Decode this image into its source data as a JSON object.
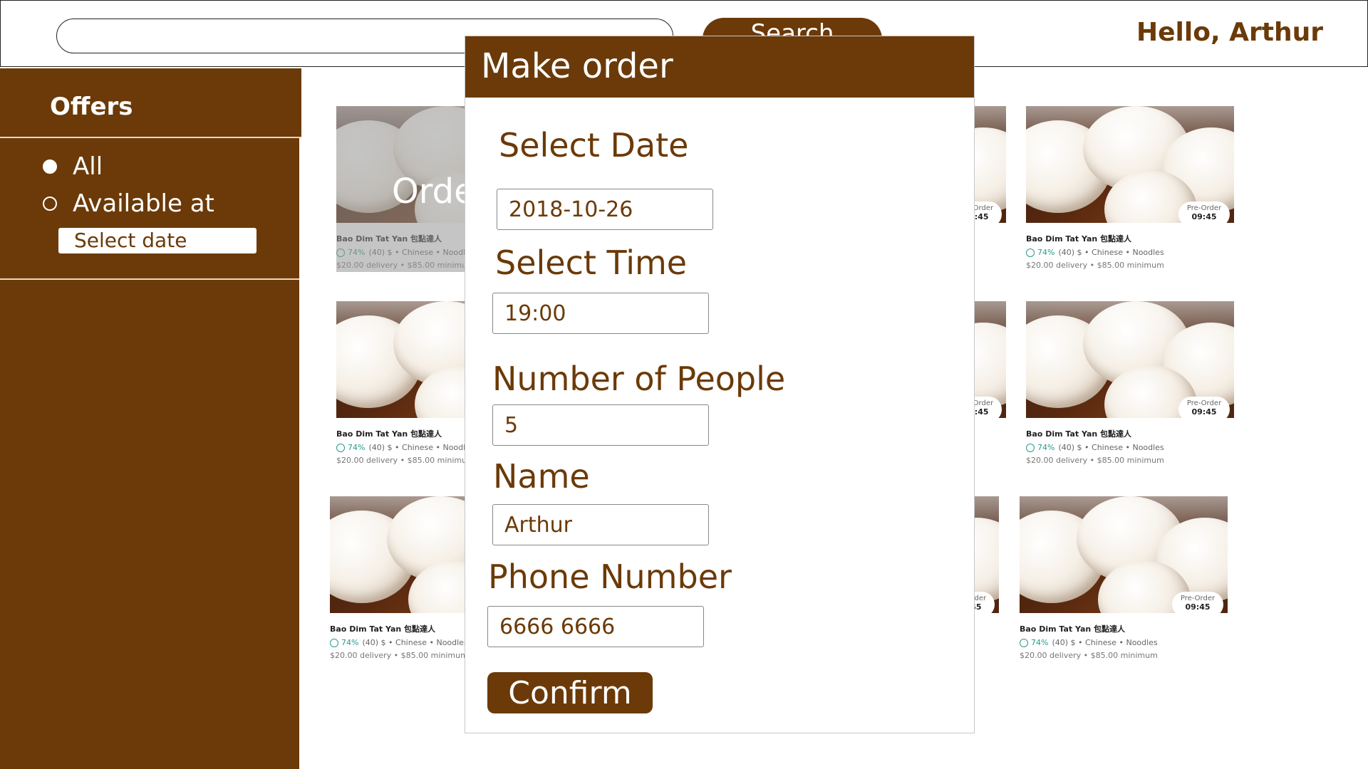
{
  "header": {
    "search_placeholder": "",
    "search_button": "Search",
    "greeting": "Hello, Arthur"
  },
  "sidebar": {
    "title": "Offers",
    "options": [
      {
        "label": "All",
        "selected": true
      },
      {
        "label": "Available at",
        "selected": false
      }
    ],
    "date_placeholder": "Select date"
  },
  "restaurants": [
    {
      "name": "Bao Dim Tat Yan 包點達人",
      "rating": "74%",
      "reviews": "(40)",
      "price": "$",
      "tags": "Chinese • Noodles",
      "delivery": "$20.00 delivery • $85.00 minimum",
      "badge_label": "Pre-Order",
      "badge_time": "09:45"
    }
  ],
  "dimmed_card": {
    "overlay_text": "Order"
  },
  "modal": {
    "title": "Make order",
    "date_label": "Select Date",
    "date_value": "2018-10-26",
    "time_label": "Select Time",
    "time_value": "19:00",
    "people_label": "Number of People",
    "people_value": "5",
    "name_label": "Name",
    "name_value": "Arthur",
    "phone_label": "Phone Number",
    "phone_value": "6666 6666",
    "confirm": "Confirm"
  },
  "colors": {
    "brand": "#6b3a08",
    "white": "#ffffff",
    "rating": "#2a9a8a"
  }
}
